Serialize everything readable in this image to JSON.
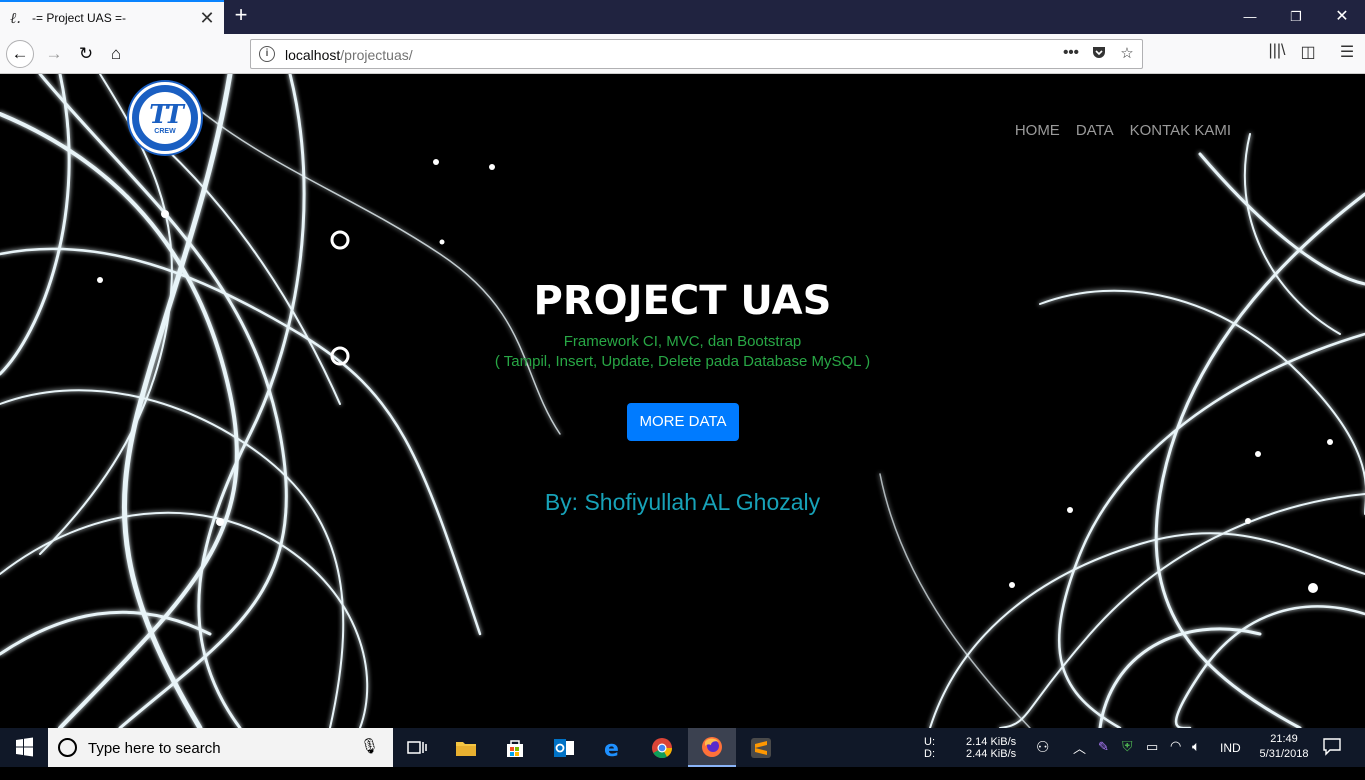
{
  "browser": {
    "tab_title": "-= Project UAS =-",
    "url_host": "localhost",
    "url_path": "/projectuas/"
  },
  "site": {
    "logo_text": "TT",
    "logo_subtext": "CREW",
    "nav": [
      "HOME",
      "DATA",
      "KONTAK KAMI"
    ],
    "title": "PROJECT UAS",
    "subtitle_line1": "Framework CI, MVC, dan Bootstrap",
    "subtitle_line2": "( Tampil, Insert, Update, Delete pada Database MySQL )",
    "button_label": "MORE DATA",
    "author": "By: Shofiyullah AL Ghozaly",
    "colors": {
      "subtitle": "#28a745",
      "button": "#007bff",
      "author": "#17a2b8"
    }
  },
  "taskbar": {
    "search_placeholder": "Type here to search",
    "net_up_label": "U:",
    "net_down_label": "D:",
    "net_up": "2.14 KiB/s",
    "net_down": "2.44 KiB/s",
    "language": "IND",
    "time": "21:49",
    "date": "5/31/2018"
  }
}
